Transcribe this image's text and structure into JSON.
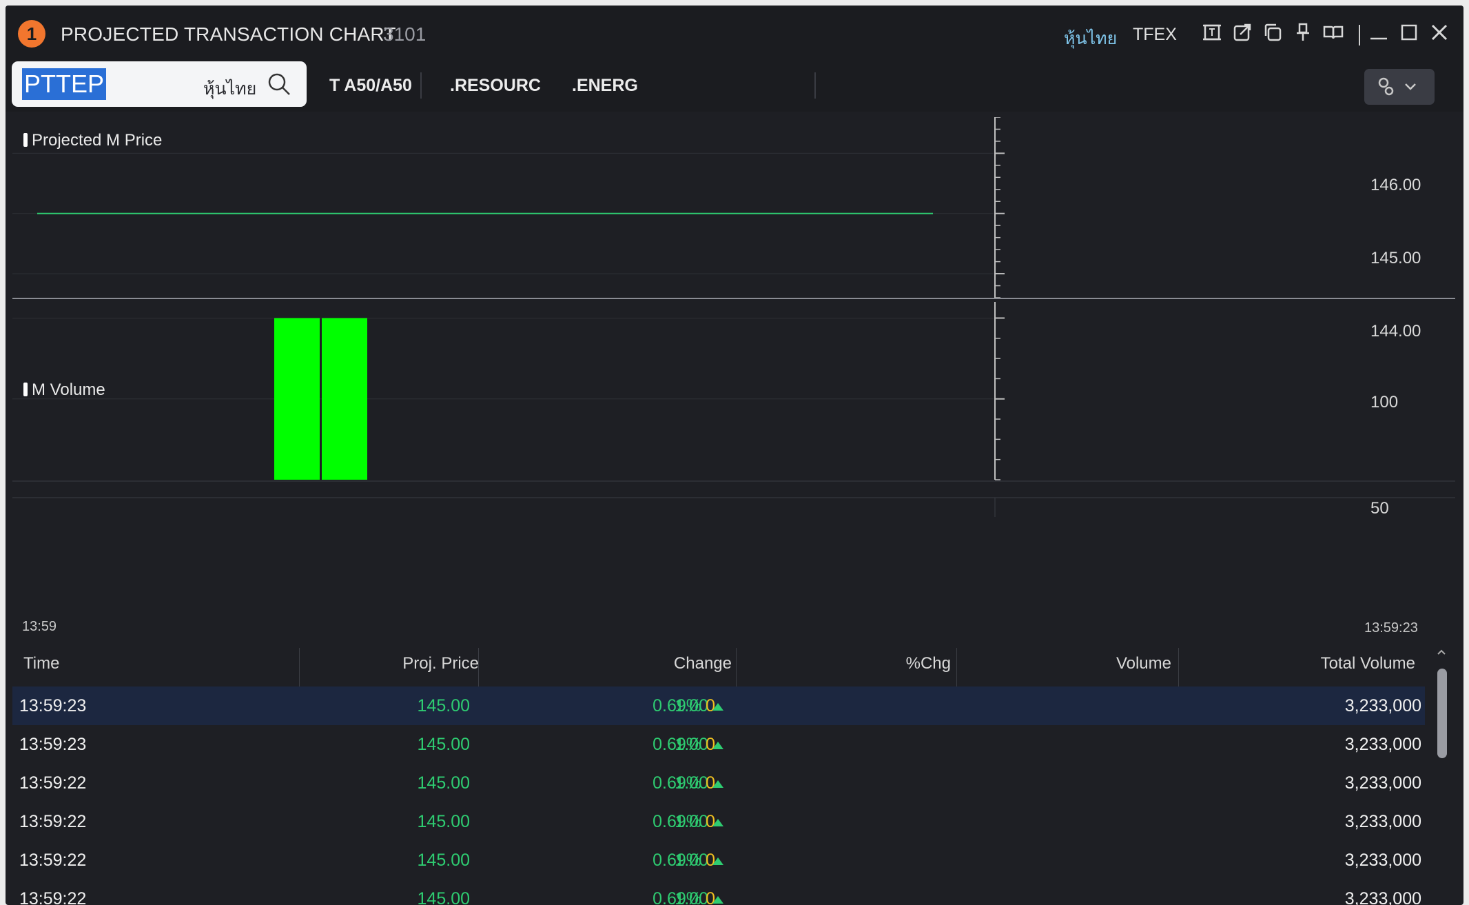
{
  "window": {
    "badge": "1",
    "title": "PROJECTED TRANSACTION CHART",
    "code": "3101",
    "market_thai": "หุ้นไทย",
    "market_tfex": "TFEX"
  },
  "toolbar": {
    "symbol": "PTTEP",
    "search_market": "หุ้นไทย",
    "quick_links": [
      "T A50/A50",
      ".RESOURC",
      ".ENERG"
    ]
  },
  "price_panel": {
    "label": "Projected M Price",
    "y_ticks": [
      "146.00",
      "145.00",
      "144.00"
    ]
  },
  "volume_panel": {
    "label": "M Volume",
    "y_ticks": [
      "100",
      "50"
    ],
    "x_start": "13:59",
    "x_end": "13:59:23"
  },
  "chart_data": [
    {
      "type": "line",
      "title": "Projected M Price",
      "ylim": [
        143.6,
        146.6
      ],
      "series": [
        {
          "values": [
            145.0,
            145.0
          ]
        }
      ],
      "y_ticks": [
        146.0,
        145.0,
        144.0
      ],
      "color": "#2ecc71"
    },
    {
      "type": "bar",
      "title": "M Volume",
      "ylim": [
        0,
        110
      ],
      "values": [
        100,
        100
      ],
      "y_ticks": [
        100,
        50
      ],
      "x_labels": [
        "13:59",
        "13:59:23"
      ],
      "color": "#00ff00"
    }
  ],
  "table": {
    "headers": [
      "Time",
      "Proj. Price",
      "Change",
      "%Chg",
      "Volume",
      "Total Volume"
    ],
    "rows": [
      {
        "time": "13:59:23",
        "price": "145.00",
        "change": "1.00",
        "pchg": "0.69%",
        "volume": "0",
        "total": "3,233,000"
      },
      {
        "time": "13:59:23",
        "price": "145.00",
        "change": "1.00",
        "pchg": "0.69%",
        "volume": "0",
        "total": "3,233,000"
      },
      {
        "time": "13:59:22",
        "price": "145.00",
        "change": "1.00",
        "pchg": "0.69%",
        "volume": "0",
        "total": "3,233,000"
      },
      {
        "time": "13:59:22",
        "price": "145.00",
        "change": "1.00",
        "pchg": "0.69%",
        "volume": "0",
        "total": "3,233,000"
      },
      {
        "time": "13:59:22",
        "price": "145.00",
        "change": "1.00",
        "pchg": "0.69%",
        "volume": "0",
        "total": "3,233,000"
      },
      {
        "time": "13:59:22",
        "price": "145.00",
        "change": "1.00",
        "pchg": "0.69%",
        "volume": "0",
        "total": "3,233,000"
      }
    ]
  },
  "colors": {
    "background": "#1e1f24",
    "up": "#2ecc71",
    "volume_bar": "#00ff00",
    "volume_text": "#f0c020",
    "selection": "#2a6fd6",
    "badge": "#f2762e"
  }
}
